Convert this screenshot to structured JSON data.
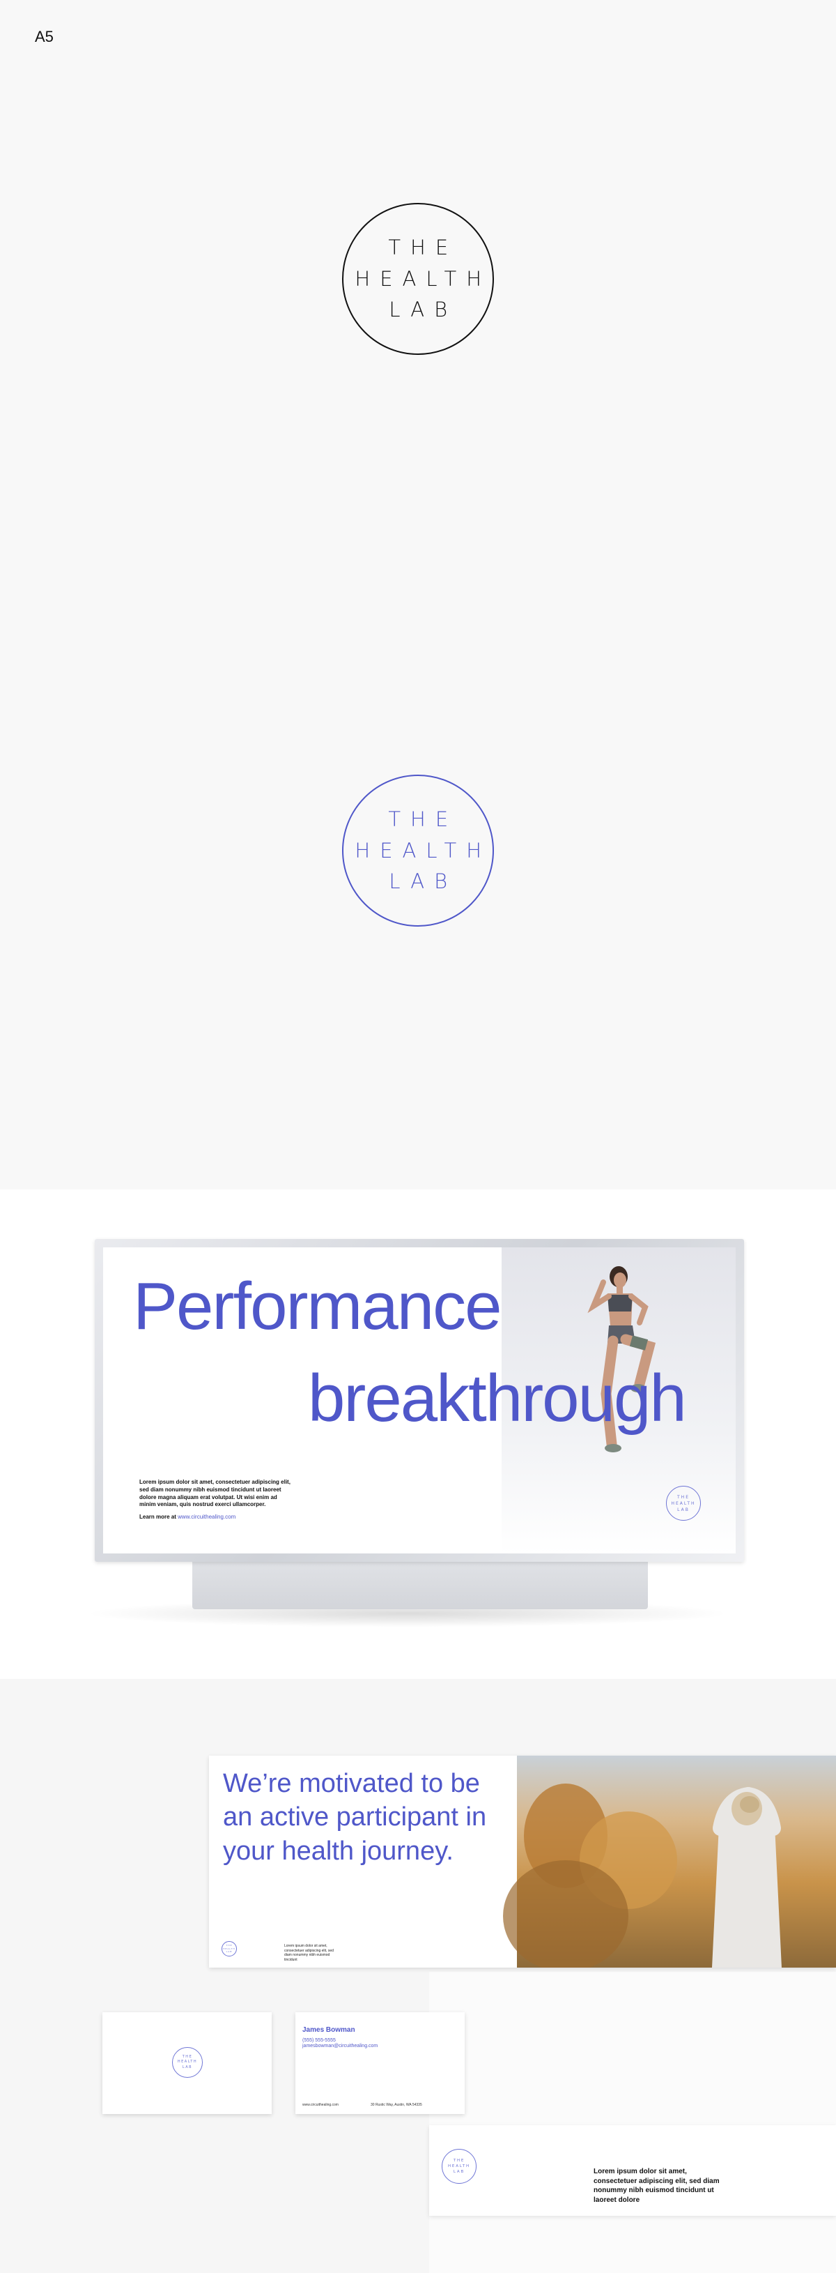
{
  "page_label": "A5",
  "logo": {
    "line1": "THE",
    "line2": "HEALTH",
    "line3": "LAB"
  },
  "colors": {
    "brand_blue": "#4f57c9",
    "black": "#111111"
  },
  "billboard": {
    "headline_line1": "Performance",
    "headline_line2": "breakthrough",
    "body": "Lorem ipsum dolor sit amet, consectetuer adipiscing elit, sed diam nonummy nibh euismod tincidunt ut laoreet dolore magna aliquam erat volutpat. Ut wisi enim ad minim veniam, quis nostrud exerci ullamcorper.",
    "learn_more_label": "Learn more at",
    "learn_more_url": "www.circuithealing.com"
  },
  "banner": {
    "headline": "We’re motivated to be an active participant in your health journey.",
    "small_text": "Lorem ipsum dolor sit amet, consectetuer adipiscing elit, sed diam nonummy nibh euismod tincidunt"
  },
  "business_card": {
    "name": "James Bowman",
    "phone": "(555) 555-5555",
    "email": "jamesbowman@circuithealing.com",
    "website": "www.circuithealing.com",
    "address": "30 Rustic Way, Austin, WA 54335"
  },
  "letterhead": {
    "body": "Lorem ipsum dolor sit amet, consectetuer adipiscing elit, sed diam nonummy nibh euismod tincidunt ut laoreet dolore"
  }
}
